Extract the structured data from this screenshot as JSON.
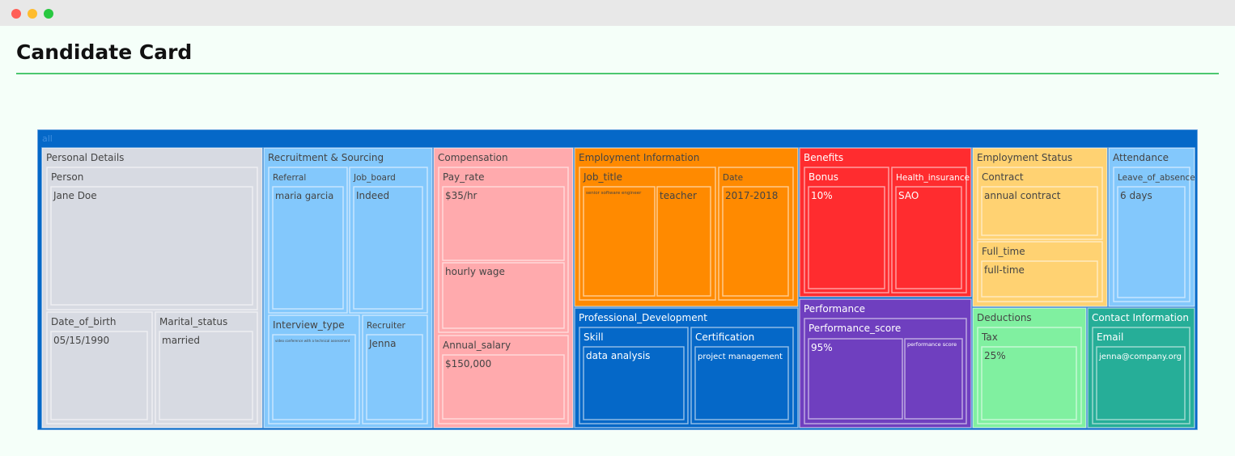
{
  "window": {
    "title": "Candidate Card"
  },
  "chart_data": {
    "type": "treemap",
    "title": "Candidate Card",
    "root": "all",
    "groups": [
      {
        "name": "Personal Details",
        "color": "#d7dae2",
        "children": [
          {
            "name": "Person",
            "children": [
              {
                "name": "Jane Doe"
              }
            ]
          },
          {
            "name": "Date_of_birth",
            "children": [
              {
                "name": "05/15/1990"
              }
            ]
          },
          {
            "name": "Marital_status",
            "children": [
              {
                "name": "married"
              }
            ]
          }
        ]
      },
      {
        "name": "Recruitment & Sourcing",
        "color": "#83c8fc",
        "children": [
          {
            "name": "Referral",
            "children": [
              {
                "name": "maria garcia"
              }
            ]
          },
          {
            "name": "Job_board",
            "children": [
              {
                "name": "Indeed"
              }
            ]
          },
          {
            "name": "Interview_type",
            "children": [
              {
                "name": "video conference with a technical assessment"
              }
            ]
          },
          {
            "name": "Recruiter",
            "children": [
              {
                "name": "Jenna"
              }
            ]
          }
        ]
      },
      {
        "name": "Compensation",
        "color": "#ffaaad",
        "children": [
          {
            "name": "Pay_rate",
            "children": [
              {
                "name": "$35/hr"
              },
              {
                "name": "hourly wage"
              }
            ]
          },
          {
            "name": "Annual_salary",
            "children": [
              {
                "name": "$150,000"
              }
            ]
          }
        ]
      },
      {
        "name": "Employment Information",
        "color": "#ff8a00",
        "children": [
          {
            "name": "Job_title",
            "children": [
              {
                "name": "senior software engineer"
              },
              {
                "name": "teacher"
              }
            ]
          },
          {
            "name": "Date",
            "children": [
              {
                "name": "2017-2018"
              }
            ]
          }
        ]
      },
      {
        "name": "Professional_Development",
        "color": "#0568c8",
        "children": [
          {
            "name": "Skill",
            "children": [
              {
                "name": "data analysis"
              }
            ]
          },
          {
            "name": "Certification",
            "children": [
              {
                "name": "project management"
              }
            ]
          }
        ]
      },
      {
        "name": "Benefits",
        "color": "#ff2c2f",
        "children": [
          {
            "name": "Bonus",
            "children": [
              {
                "name": "10%"
              }
            ]
          },
          {
            "name": "Health_insurance",
            "children": [
              {
                "name": "SAO"
              }
            ]
          }
        ]
      },
      {
        "name": "Performance",
        "color": "#6f3fbf",
        "children": [
          {
            "name": "Performance_score",
            "children": [
              {
                "name": "95%"
              },
              {
                "name": "performance score"
              }
            ]
          }
        ]
      },
      {
        "name": "Employment Status",
        "color": "#ffd272",
        "children": [
          {
            "name": "Contract",
            "children": [
              {
                "name": "annual contract"
              }
            ]
          },
          {
            "name": "Full_time",
            "children": [
              {
                "name": "full-time"
              }
            ]
          }
        ]
      },
      {
        "name": "Attendance",
        "color": "#83c8fc",
        "children": [
          {
            "name": "Leave_of_absence",
            "children": [
              {
                "name": "6 days"
              }
            ]
          }
        ]
      },
      {
        "name": "Deductions",
        "color": "#80f0a0",
        "children": [
          {
            "name": "Tax",
            "children": [
              {
                "name": "25%"
              }
            ]
          }
        ]
      },
      {
        "name": "Contact Information",
        "color": "#26ae98",
        "children": [
          {
            "name": "Email",
            "children": [
              {
                "name": "jenna@company.org"
              }
            ]
          }
        ]
      }
    ]
  }
}
